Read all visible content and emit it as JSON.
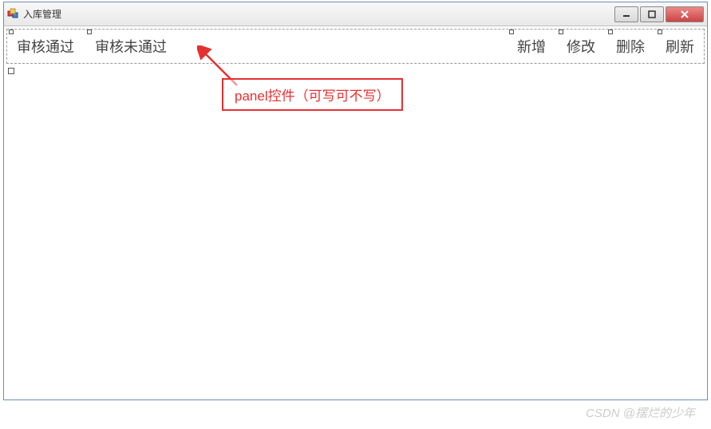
{
  "window": {
    "title": "入库管理"
  },
  "toolbar": {
    "left": [
      {
        "label": "审核通过"
      },
      {
        "label": "审核未通过"
      }
    ],
    "right": [
      {
        "label": "新增"
      },
      {
        "label": "修改"
      },
      {
        "label": "删除"
      },
      {
        "label": "刷新"
      }
    ]
  },
  "annotation": {
    "text": "panel控件（可写可不写）"
  },
  "watermark": "CSDN @摆烂的少年"
}
